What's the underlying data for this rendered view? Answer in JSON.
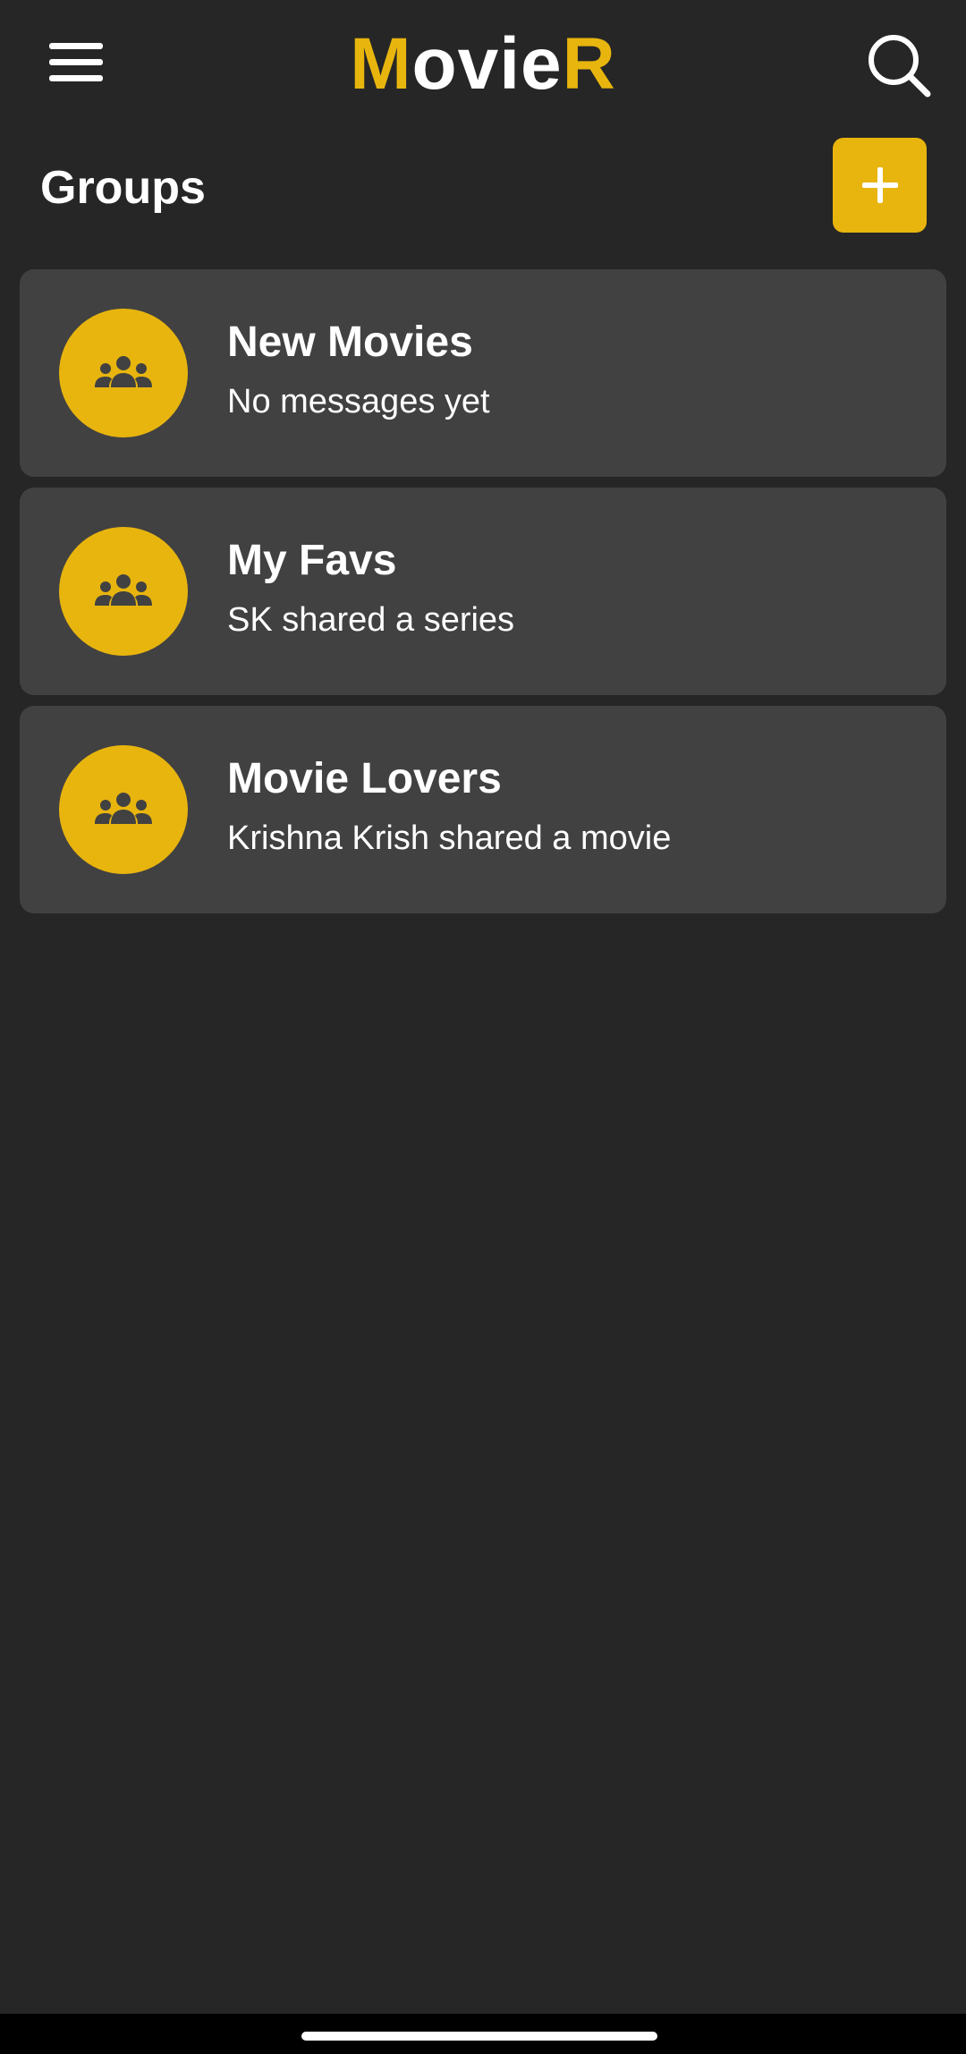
{
  "app": {
    "logo_first": "M",
    "logo_middle": "ovie",
    "logo_last": "R",
    "accent_color": "#e8b50e",
    "background_color": "#262626",
    "card_color": "#414141"
  },
  "toolbar": {
    "menu_icon": "hamburger-menu-icon",
    "search_icon": "search-icon"
  },
  "groups": {
    "title": "Groups",
    "add_icon": "plus-icon",
    "items": [
      {
        "name": "New Movies",
        "subtitle": "No messages yet",
        "icon": "group-icon"
      },
      {
        "name": "My Favs",
        "subtitle": "SK shared a series",
        "icon": "group-icon"
      },
      {
        "name": "Movie Lovers",
        "subtitle": "Krishna Krish shared a movie",
        "icon": "group-icon"
      }
    ]
  }
}
